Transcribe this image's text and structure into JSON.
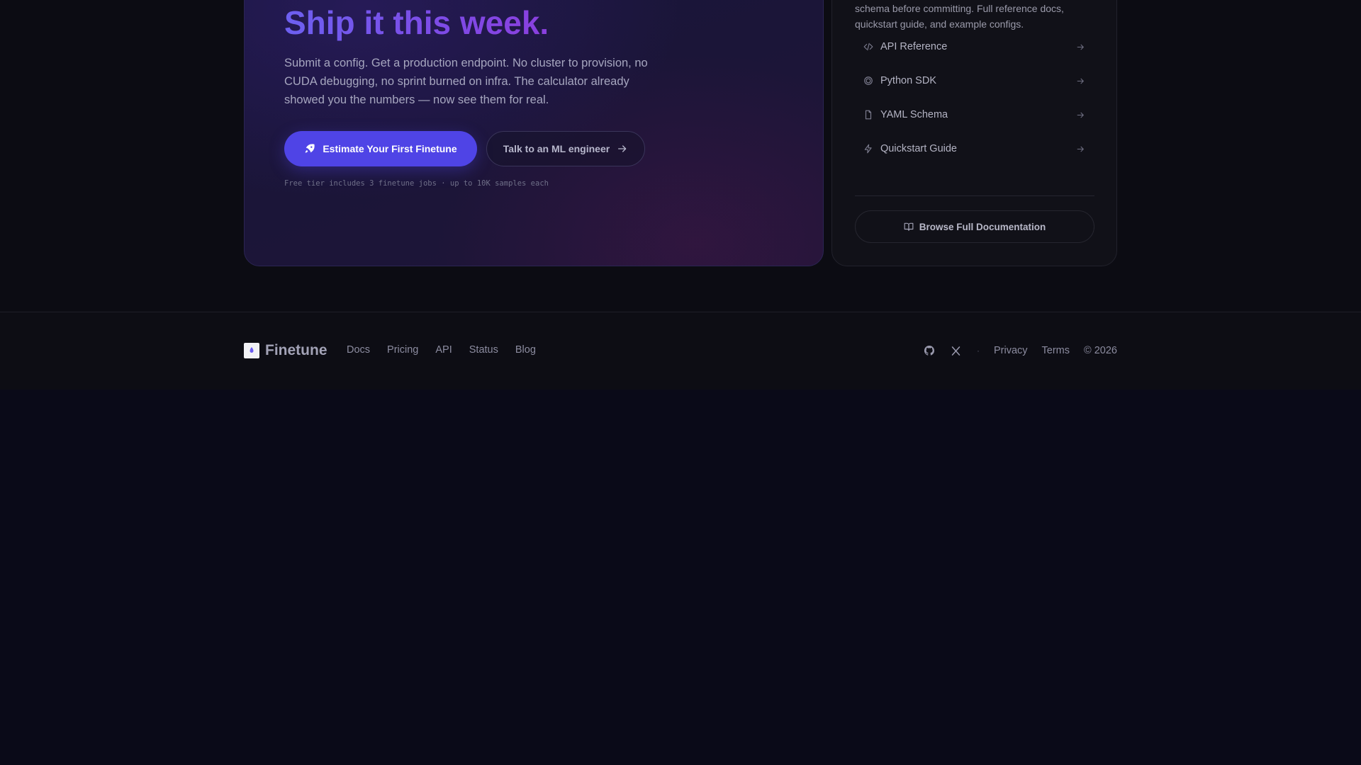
{
  "hero": {
    "title": "Ship it this week.",
    "description": "Submit a config. Get a production endpoint. No cluster to provision, no CUDA debugging, no sprint burned on infra. The calculator already showed you the numbers — now see them for real.",
    "primary_button": "Estimate Your First Finetune",
    "secondary_button": "Talk to an ML engineer",
    "free_tier_note": "Free tier includes 3 finetune jobs · up to 10K samples each"
  },
  "docs": {
    "description": "schema before committing. Full reference docs, quickstart guide, and example configs.",
    "items": [
      {
        "label": "API Reference",
        "icon": "code-icon"
      },
      {
        "label": "Python SDK",
        "icon": "package-icon"
      },
      {
        "label": "YAML Schema",
        "icon": "file-icon"
      },
      {
        "label": "Quickstart Guide",
        "icon": "lightning-icon"
      }
    ],
    "browse_button": "Browse Full Documentation"
  },
  "footer": {
    "brand": "Finetune",
    "nav": [
      "Docs",
      "Pricing",
      "API",
      "Status",
      "Blog"
    ],
    "separator": "·",
    "links": [
      "Privacy",
      "Terms"
    ],
    "copyright": "© 2026"
  },
  "colors": {
    "accent": "#4f44e6",
    "background": "#0a0a18",
    "card": "#111118"
  }
}
